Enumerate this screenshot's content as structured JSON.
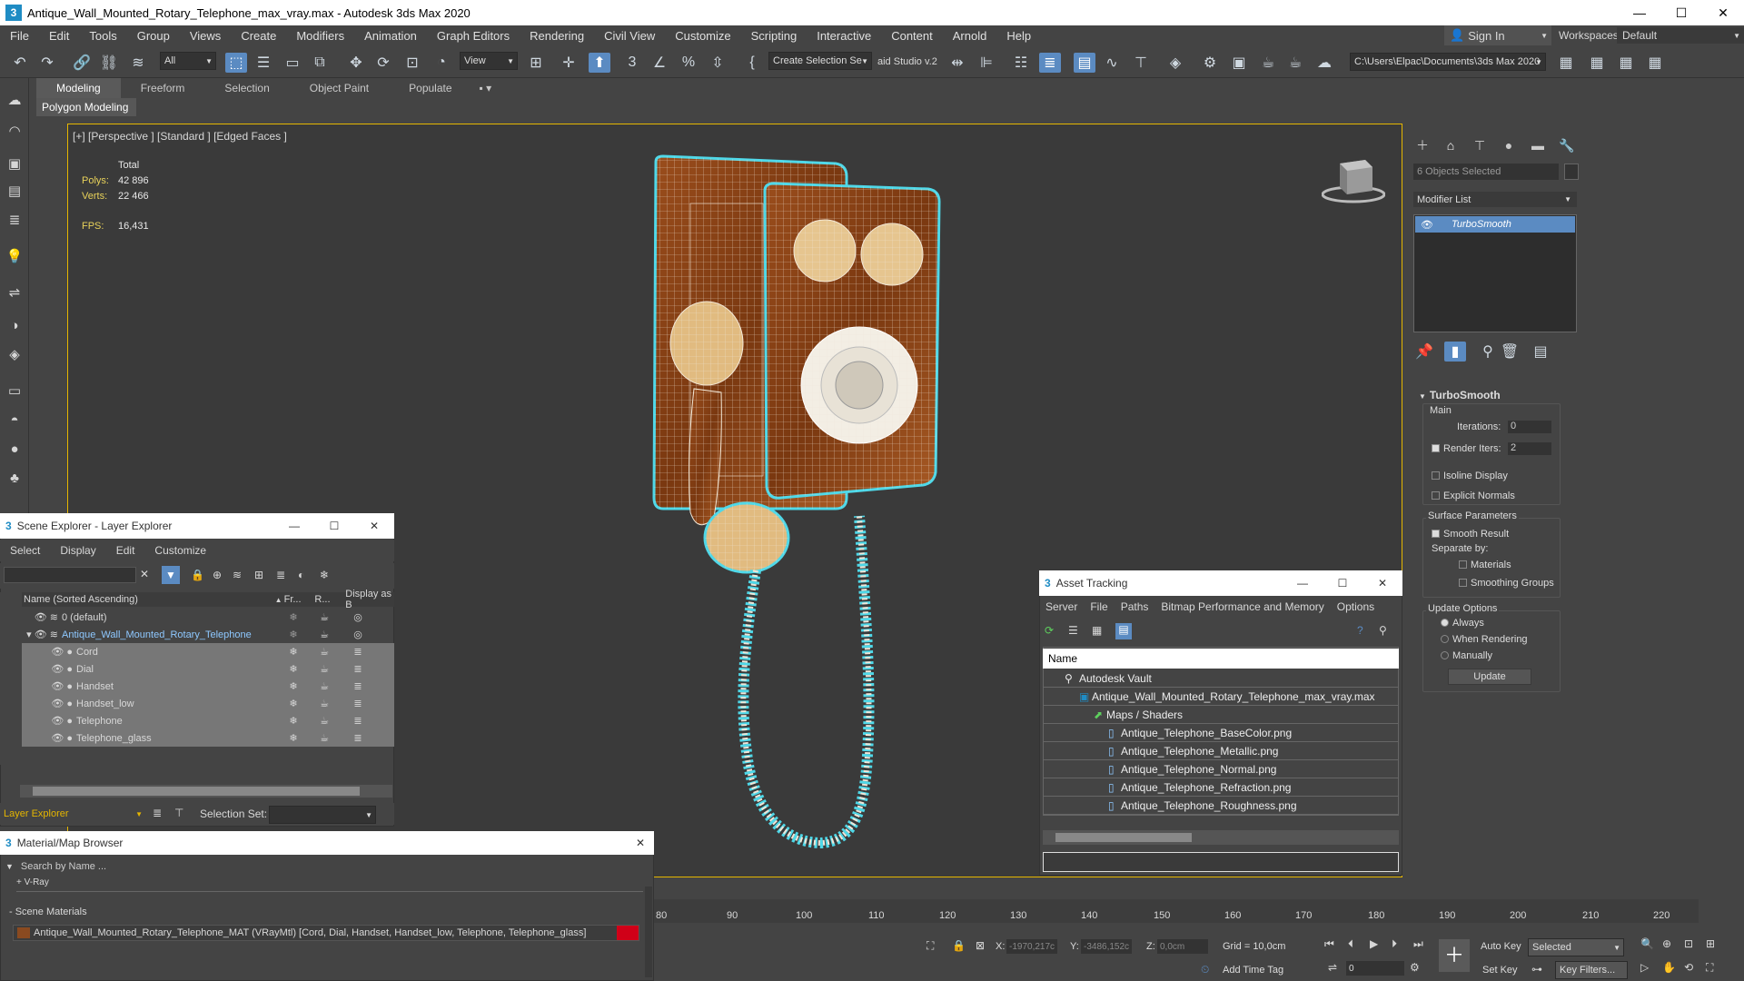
{
  "window": {
    "title": "Antique_Wall_Mounted_Rotary_Telephone_max_vray.max - Autodesk 3ds Max 2020",
    "app_icon": "3",
    "minimize": "—",
    "maximize": "☐",
    "close": "✕"
  },
  "menu": [
    "File",
    "Edit",
    "Tools",
    "Group",
    "Views",
    "Create",
    "Modifiers",
    "Animation",
    "Graph Editors",
    "Rendering",
    "Civil View",
    "Customize",
    "Scripting",
    "Interactive",
    "Content",
    "Arnold",
    "Help"
  ],
  "account": {
    "signin_label": "Sign In",
    "workspaces_label": "Workspaces:",
    "workspace_value": "Default"
  },
  "toolbar": {
    "filter_value": "All",
    "view_value": "View",
    "selection_set": "Create Selection Se",
    "studio_label": "aid Studio v.2",
    "project_path": "C:\\Users\\Elpac\\Documents\\3ds Max 2020"
  },
  "ribbon": {
    "tabs": [
      "Modeling",
      "Freeform",
      "Selection",
      "Object Paint",
      "Populate"
    ],
    "active_tab": "Modeling",
    "sub_panel": "Polygon Modeling"
  },
  "viewport": {
    "label": "[+] [Perspective ] [Standard ] [Edged Faces ]",
    "stats": {
      "total_label": "Total",
      "polys_label": "Polys:",
      "polys_value": "42 896",
      "verts_label": "Verts:",
      "verts_value": "22 466",
      "fps_label": "FPS:",
      "fps_value": "16,431"
    },
    "wire_color": "#4fd8e8",
    "accent_border": "#e5b600"
  },
  "command_panel": {
    "selection_info": "6 Objects Selected",
    "modifier_list": "Modifier List",
    "modifier": "TurboSmooth",
    "rollout_title": "TurboSmooth",
    "main_label": "Main",
    "iterations_label": "Iterations:",
    "iterations_value": "0",
    "render_iters_label": "Render Iters:",
    "render_iters_value": "2",
    "isoline_label": "Isoline Display",
    "explicit_normals_label": "Explicit Normals",
    "surface_params_label": "Surface Parameters",
    "smooth_result_label": "Smooth Result",
    "separate_by_label": "Separate by:",
    "materials_label": "Materials",
    "smoothing_groups_label": "Smoothing Groups",
    "update_options_label": "Update Options",
    "always_label": "Always",
    "when_rendering_label": "When Rendering",
    "manually_label": "Manually",
    "update_button": "Update"
  },
  "scene_explorer": {
    "title": "Scene Explorer - Layer Explorer",
    "menu": [
      "Select",
      "Display",
      "Edit",
      "Customize"
    ],
    "col_name": "Name (Sorted Ascending)",
    "col_fr": "Fr...",
    "col_r": "R...",
    "col_display": "Display as B",
    "rows": [
      {
        "name": "0 (default)",
        "indent": 0,
        "selected": false
      },
      {
        "name": "Antique_Wall_Mounted_Rotary_Telephone",
        "indent": 0,
        "selected": false
      },
      {
        "name": "Cord",
        "indent": 1,
        "selected": true
      },
      {
        "name": "Dial",
        "indent": 1,
        "selected": true
      },
      {
        "name": "Handset",
        "indent": 1,
        "selected": true
      },
      {
        "name": "Handset_low",
        "indent": 1,
        "selected": true
      },
      {
        "name": "Telephone",
        "indent": 1,
        "selected": true
      },
      {
        "name": "Telephone_glass",
        "indent": 1,
        "selected": true
      }
    ],
    "footer_label": "Layer Explorer",
    "selection_set_label": "Selection Set:"
  },
  "material_browser": {
    "title": "Material/Map Browser",
    "search_placeholder": "Search by Name ...",
    "vray_group": "+ V-Ray",
    "scene_materials": "- Scene Materials",
    "material_entry": "Antique_Wall_Mounted_Rotary_Telephone_MAT  (VRayMtl) [Cord, Dial, Handset, Handset_low, Telephone, Telephone_glass]"
  },
  "asset_tracking": {
    "title": "Asset Tracking",
    "menu": [
      "Server",
      "File",
      "Paths",
      "Bitmap Performance and Memory",
      "Options"
    ],
    "col_name": "Name",
    "rows": [
      {
        "name": "Autodesk Vault",
        "indent": 1
      },
      {
        "name": "Antique_Wall_Mounted_Rotary_Telephone_max_vray.max",
        "indent": 2
      },
      {
        "name": "Maps / Shaders",
        "indent": 3
      },
      {
        "name": "Antique_Telephone_BaseColor.png",
        "indent": 4
      },
      {
        "name": "Antique_Telephone_Metallic.png",
        "indent": 4
      },
      {
        "name": "Antique_Telephone_Normal.png",
        "indent": 4
      },
      {
        "name": "Antique_Telephone_Refraction.png",
        "indent": 4
      },
      {
        "name": "Antique_Telephone_Roughness.png",
        "indent": 4
      }
    ]
  },
  "timeline": {
    "ticks": [
      "80",
      "90",
      "100",
      "110",
      "120",
      "130",
      "140",
      "150",
      "160",
      "170",
      "180",
      "190",
      "200",
      "210",
      "220"
    ]
  },
  "status": {
    "x_label": "X:",
    "x_value": "-1970,217c",
    "y_label": "Y:",
    "y_value": "-3486,152c",
    "z_label": "Z:",
    "z_value": "0,0cm",
    "grid": "Grid = 10,0cm",
    "add_time_tag": "Add Time Tag",
    "frame_value": "0",
    "auto_key": "Auto Key",
    "set_key": "Set Key",
    "selected_value": "Selected",
    "key_filters": "Key Filters..."
  }
}
